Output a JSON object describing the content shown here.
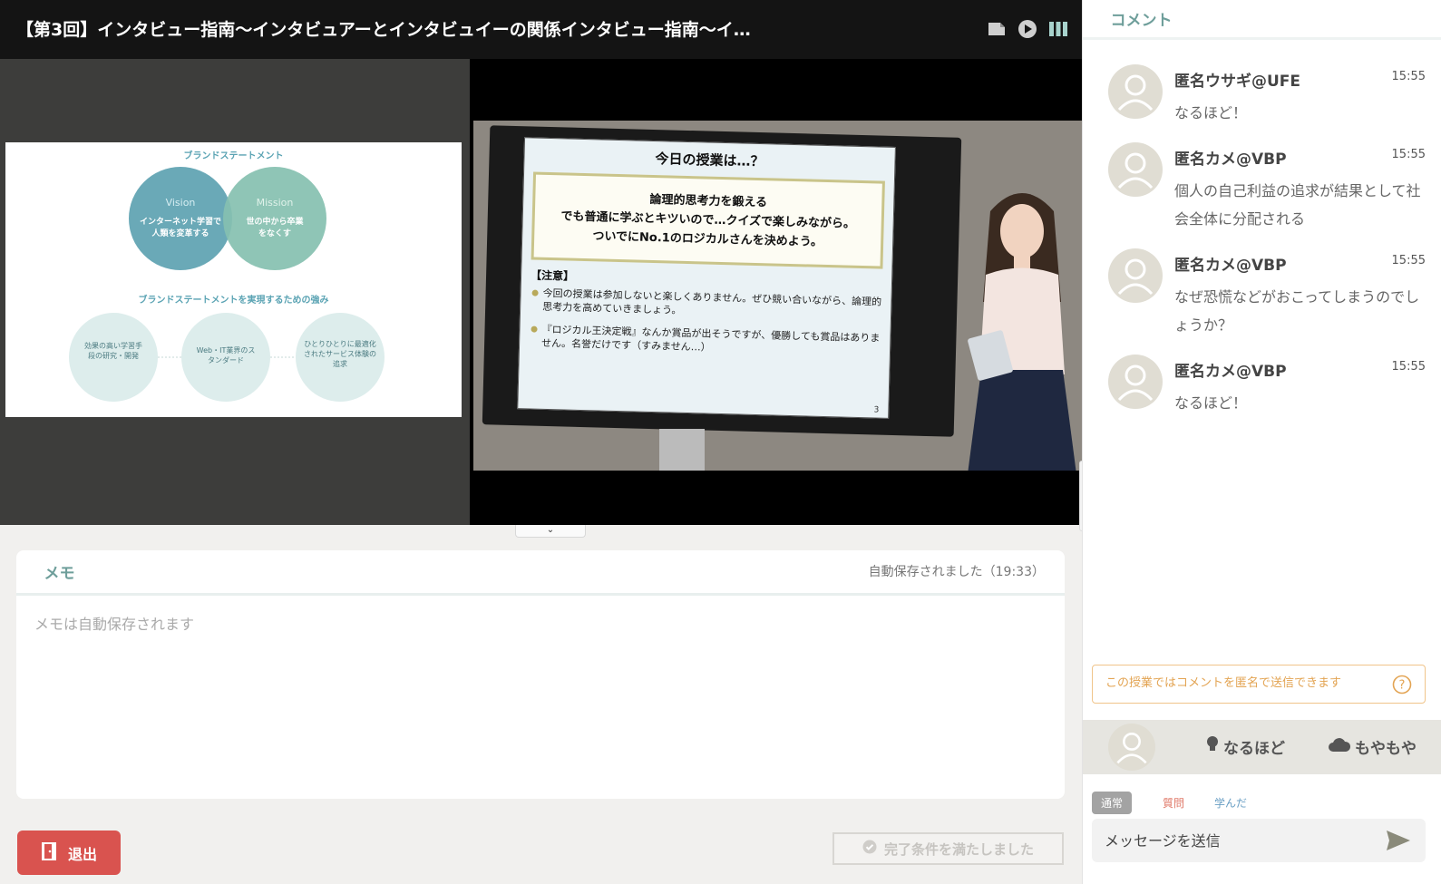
{
  "header": {
    "title": "【第3回】インタビュー指南〜インタビュアーとインタビュイーの関係インタビュー指南〜イ…"
  },
  "slide": {
    "brand_statement": "ブランドステートメント",
    "vision_title": "Vision",
    "vision_text": "インターネット学習で人類を変革する",
    "mission_title": "Mission",
    "mission_text": "世の中から卒業をなくす",
    "strengths_title": "ブランドステートメントを実現するための強み",
    "strengths": [
      "効果の高い学習手段の研究・開発",
      "Web・IT業界のスタンダード",
      "ひとりひとりに最適化されたサービス体験の追求"
    ]
  },
  "tv_slide": {
    "heading": "今日の授業は…？",
    "box_lines": [
      "論理的思考力を鍛える",
      "でも普通に学ぶとキツいので…クイズで楽しみながら。",
      "ついでにNo.1のロジカルさんを決めよう。"
    ],
    "note_label": "【注意】",
    "bullets": [
      "今回の授業は参加しないと楽しくありません。ぜひ競い合いながら、論理的思考力を高めていきましょう。",
      "『ロジカル王決定戦』なんか賞品が出そうですが、優勝しても賞品はありません。名誉だけです（すみません…）"
    ],
    "page": "3"
  },
  "memo": {
    "tab_label": "メモ",
    "status": "自動保存されました（19:33）",
    "placeholder": "メモは自動保存されます",
    "value": ""
  },
  "footer": {
    "exit_label": "退出",
    "complete_label": "完了条件を満たしました"
  },
  "comments_panel": {
    "tab_label": "コメント",
    "items": [
      {
        "name": "匿名ウサギ@UFE",
        "time": "15:55",
        "text": "なるほど！"
      },
      {
        "name": "匿名カメ@VBP",
        "time": "15:55",
        "text": "個人の自己利益の追求が結果として社会全体に分配される"
      },
      {
        "name": "匿名カメ@VBP",
        "time": "15:55",
        "text": "なぜ恐慌などがおこってしまうのでしょうか？"
      },
      {
        "name": "匿名カメ@VBP",
        "time": "15:55",
        "text": "なるほど！"
      }
    ],
    "anon_note": "この授業ではコメントを匿名で送信できます",
    "reactions": {
      "naruhodo": "なるほど",
      "moyamoya": "もやもや"
    },
    "modes": [
      "通常",
      "質問",
      "学んだ"
    ],
    "message_placeholder": "メッセージを送信"
  },
  "colors": {
    "accent_teal": "#7fb5b0",
    "exit_red": "#d9534f",
    "note_orange": "#e3a453",
    "mode_question": "#e07a6a",
    "mode_learned": "#6a9fc4"
  }
}
